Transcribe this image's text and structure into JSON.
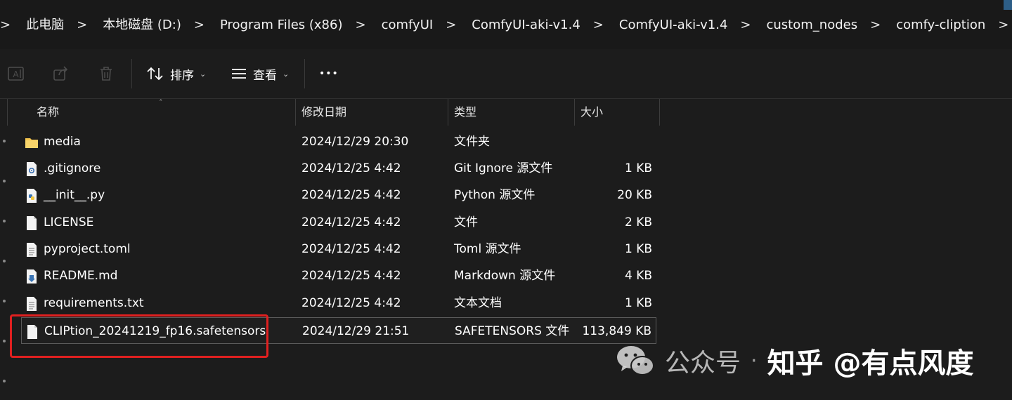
{
  "breadcrumb": {
    "items": [
      {
        "label": "此电脑"
      },
      {
        "label": "本地磁盘 (D:)"
      },
      {
        "label": "Program Files (x86)"
      },
      {
        "label": "comfyUI"
      },
      {
        "label": "ComfyUI-aki-v1.4"
      },
      {
        "label": "ComfyUI-aki-v1.4"
      },
      {
        "label": "custom_nodes"
      },
      {
        "label": "comfy-cliption"
      }
    ],
    "separator": ">"
  },
  "toolbar": {
    "rename_icon": "rename-icon",
    "share_icon": "share-icon",
    "delete_icon": "trash-icon",
    "sort_label": "排序",
    "view_label": "查看",
    "more_label": "•••"
  },
  "columns": {
    "name": "名称",
    "date": "修改日期",
    "type": "类型",
    "size": "大小"
  },
  "files": [
    {
      "icon": "folder-icon",
      "name": "media",
      "date": "2024/12/29 20:30",
      "type": "文件夹",
      "size": ""
    },
    {
      "icon": "settings-file-icon",
      "name": ".gitignore",
      "date": "2024/12/25 4:42",
      "type": "Git Ignore 源文件",
      "size": "1 KB"
    },
    {
      "icon": "python-file-icon",
      "name": "__init__.py",
      "date": "2024/12/25 4:42",
      "type": "Python 源文件",
      "size": "20 KB"
    },
    {
      "icon": "file-icon",
      "name": "LICENSE",
      "date": "2024/12/25 4:42",
      "type": "文件",
      "size": "2 KB"
    },
    {
      "icon": "text-file-icon",
      "name": "pyproject.toml",
      "date": "2024/12/25 4:42",
      "type": "Toml 源文件",
      "size": "1 KB"
    },
    {
      "icon": "markdown-file-icon",
      "name": "README.md",
      "date": "2024/12/25 4:42",
      "type": "Markdown 源文件",
      "size": "4 KB"
    },
    {
      "icon": "text-file-icon",
      "name": "requirements.txt",
      "date": "2024/12/25 4:42",
      "type": "文本文档",
      "size": "1 KB"
    },
    {
      "icon": "file-icon",
      "name": "CLIPtion_20241219_fp16.safetensors",
      "date": "2024/12/29 21:51",
      "type": "SAFETENSORS 文件",
      "size": "113,849 KB"
    }
  ],
  "watermark": {
    "left": "公众号",
    "separator": "·",
    "right": "知乎 @有点风度"
  },
  "colors": {
    "background": "#1c1c1c",
    "highlight": "#e02020",
    "folder": "#f4c44e"
  }
}
